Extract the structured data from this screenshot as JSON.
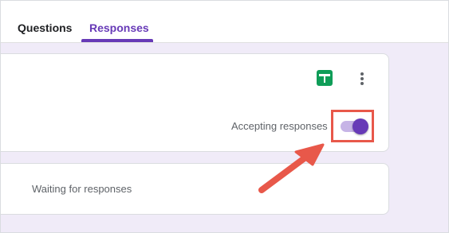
{
  "tabs": {
    "questions_label": "Questions",
    "responses_label": "Responses",
    "active": "Responses"
  },
  "responses_card": {
    "spreadsheet_icon": "google-sheets-icon",
    "more_icon": "more-vert-icon",
    "accepting_label": "Accepting responses",
    "accepting_responses": true
  },
  "status_card": {
    "message": "Waiting for responses"
  },
  "annotation": {
    "highlight_color": "#e8584a",
    "arrow_color": "#e8584a"
  },
  "colors": {
    "accent": "#673ab7",
    "page_background": "#f0ebf8",
    "sheets_green": "#0f9d58"
  }
}
